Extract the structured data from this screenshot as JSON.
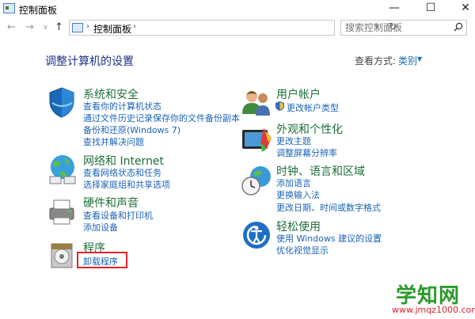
{
  "window": {
    "title": "控制面板",
    "minimize": "—",
    "maximize": "☐",
    "close": "✕"
  },
  "nav": {
    "back": "←",
    "forward": "→",
    "dropdown": "∨",
    "up": "↑",
    "breadcrumb": "控制面板",
    "sep": "›",
    "addr_dropdown": "∨",
    "refresh": "↻"
  },
  "search": {
    "placeholder": "搜索控制面板"
  },
  "main": {
    "title": "调整计算机的设置",
    "view_by_label": "查看方式:",
    "view_by_value": "类别"
  },
  "categories": {
    "system": {
      "title": "系统和安全",
      "links": [
        "查看你的计算机状态",
        "通过文件历史记录保存你的文件备份副本",
        "备份和还原(Windows 7)",
        "查找并解决问题"
      ]
    },
    "network": {
      "title": "网络和 Internet",
      "links": [
        "查看网络状态和任务",
        "选择家庭组和共享选项"
      ]
    },
    "hardware": {
      "title": "硬件和声音",
      "links": [
        "查看设备和打印机",
        "添加设备"
      ]
    },
    "programs": {
      "title": "程序",
      "links": [
        "卸载程序"
      ]
    },
    "users": {
      "title": "用户帐户",
      "links": [
        "更改帐户类型"
      ]
    },
    "appearance": {
      "title": "外观和个性化",
      "links": [
        "更改主题",
        "调整屏幕分辨率"
      ]
    },
    "clock": {
      "title": "时钟、语言和区域",
      "links": [
        "添加语言",
        "更换输入法",
        "更改日期、时间或数字格式"
      ]
    },
    "ease": {
      "title": "轻松使用",
      "links": [
        "使用 Windows 建议的设置",
        "优化视觉显示"
      ]
    }
  },
  "watermark": {
    "text": "学知网",
    "url": "www.jmqz1000.com"
  },
  "colors": {
    "title_blue": "#1e3287",
    "category_green": "#1e6f3a",
    "link_blue": "#1a63b8",
    "highlight_red": "#e0242b"
  }
}
